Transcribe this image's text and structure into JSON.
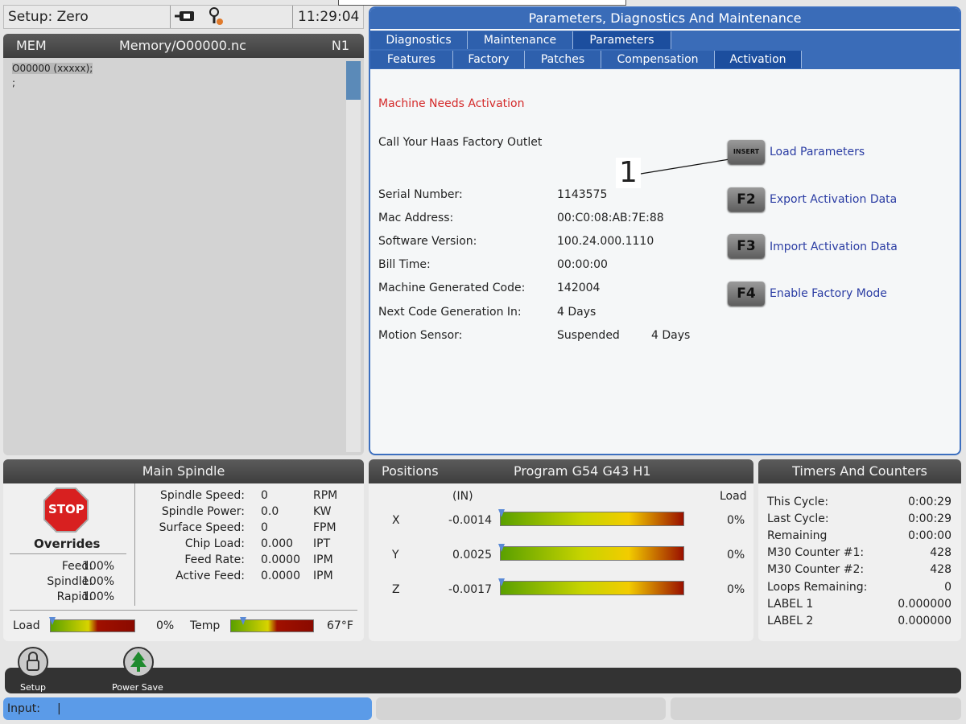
{
  "topbar": {
    "mode": "Setup: Zero",
    "time": "11:29:04"
  },
  "program": {
    "mode": "MEM",
    "path": "Memory/O00000.nc",
    "line": "N1",
    "lines": [
      "O00000 (xxxxx);",
      ";"
    ]
  },
  "param_panel": {
    "title": "Parameters, Diagnostics And Maintenance",
    "tabs_top": [
      "Diagnostics",
      "Maintenance",
      "Parameters"
    ],
    "tabs_bottom": [
      "Features",
      "Factory",
      "Patches",
      "Compensation",
      "Activation"
    ],
    "warning": "Machine Needs Activation",
    "call": "Call Your Haas Factory Outlet",
    "callout": "1",
    "fields": [
      {
        "label": "Serial Number:",
        "value": "1143575"
      },
      {
        "label": "Mac Address:",
        "value": "00:C0:08:AB:7E:88"
      },
      {
        "label": "Software Version:",
        "value": "100.24.000.1110"
      },
      {
        "label": "Bill Time:",
        "value": "00:00:00"
      },
      {
        "label": "Machine Generated Code:",
        "value": "142004"
      },
      {
        "label": "Next Code Generation In:",
        "value": "4 Days"
      },
      {
        "label": "Motion Sensor:",
        "value": "Suspended",
        "extra": "4 Days"
      }
    ],
    "actions": [
      {
        "key": "INSERT",
        "label": "Load Parameters"
      },
      {
        "key": "F2",
        "label": "Export Activation Data"
      },
      {
        "key": "F3",
        "label": "Import Activation Data"
      },
      {
        "key": "F4",
        "label": "Enable Factory Mode"
      }
    ],
    "colors": {
      "warning": "#d42a2a",
      "link": "#2a3ca3",
      "accent": "#3a6cb8"
    }
  },
  "spindle": {
    "title": "Main Spindle",
    "stop": "STOP",
    "overrides": "Overrides",
    "override_rows": [
      {
        "label": "Feed:",
        "value": "100%"
      },
      {
        "label": "Spindle:",
        "value": "100%"
      },
      {
        "label": "Rapid:",
        "value": "100%"
      }
    ],
    "stats": [
      {
        "label": "Spindle Speed:",
        "value": "0",
        "unit": "RPM"
      },
      {
        "label": "Spindle Power:",
        "value": "0.0",
        "unit": "KW"
      },
      {
        "label": "Surface Speed:",
        "value": "0",
        "unit": "FPM"
      },
      {
        "label": "Chip Load:",
        "value": "0.000",
        "unit": "IPT"
      },
      {
        "label": "Feed Rate:",
        "value": "0.0000",
        "unit": "IPM"
      },
      {
        "label": "Active Feed:",
        "value": "0.0000",
        "unit": "IPM"
      }
    ],
    "load_label": "Load",
    "load_value": "0%",
    "temp_label": "Temp",
    "temp_value": "67°F"
  },
  "positions": {
    "title": "Positions",
    "program": "Program G54 G43 H1",
    "unit": "(IN)",
    "load": "Load",
    "axes": [
      {
        "axis": "X",
        "value": "-0.0014",
        "load": "0%"
      },
      {
        "axis": "Y",
        "value": "0.0025",
        "load": "0%"
      },
      {
        "axis": "Z",
        "value": "-0.0017",
        "load": "0%"
      }
    ]
  },
  "timers": {
    "title": "Timers And Counters",
    "rows": [
      {
        "label": "This Cycle:",
        "value": "0:00:29"
      },
      {
        "label": "Last Cycle:",
        "value": "0:00:29"
      },
      {
        "label": "Remaining",
        "value": "0:00:00"
      },
      {
        "label": "M30 Counter #1:",
        "value": "428"
      },
      {
        "label": "M30 Counter #2:",
        "value": "428"
      },
      {
        "label": "Loops Remaining:",
        "value": "0"
      },
      {
        "label": "LABEL 1",
        "value": "0.000000"
      },
      {
        "label": "LABEL 2",
        "value": "0.000000"
      }
    ]
  },
  "toolbar": {
    "setup": "Setup",
    "power_save": "Power Save"
  },
  "input": {
    "label": "Input:",
    "value": "|"
  }
}
